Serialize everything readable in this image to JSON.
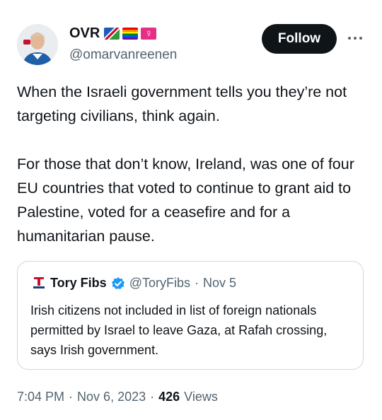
{
  "author": {
    "display_name": "OVR",
    "handle": "@omarvanreenen",
    "flags": [
      "namibia-flag-icon",
      "rainbow-flag-icon",
      "female-sign-icon"
    ],
    "female_sign_glyph": "♀"
  },
  "follow_label": "Follow",
  "tweet_text": "When the Israeli government tells you they’re not targeting civilians, think again.\n\nFor those that don’t know, Ireland, was one of four EU countries that voted to continue to grant aid to Palestine, voted for a ceasefire and for a humanitarian pause.",
  "quoted": {
    "name": "Tory Fibs",
    "handle": "@ToryFibs",
    "separator": "·",
    "date": "Nov 5",
    "text": "Irish citizens not included in list of foreign nationals permitted by Israel to leave Gaza, at Rafah crossing, says Irish government."
  },
  "meta": {
    "time": "7:04 PM",
    "separator": "·",
    "date": "Nov 6, 2023",
    "views_count": "426",
    "views_label": "Views"
  },
  "colors": {
    "text_primary": "#0f1419",
    "text_secondary": "#536471",
    "follow_bg": "#0f1419",
    "verified": "#1d9bf0",
    "border": "#cfd9de"
  }
}
